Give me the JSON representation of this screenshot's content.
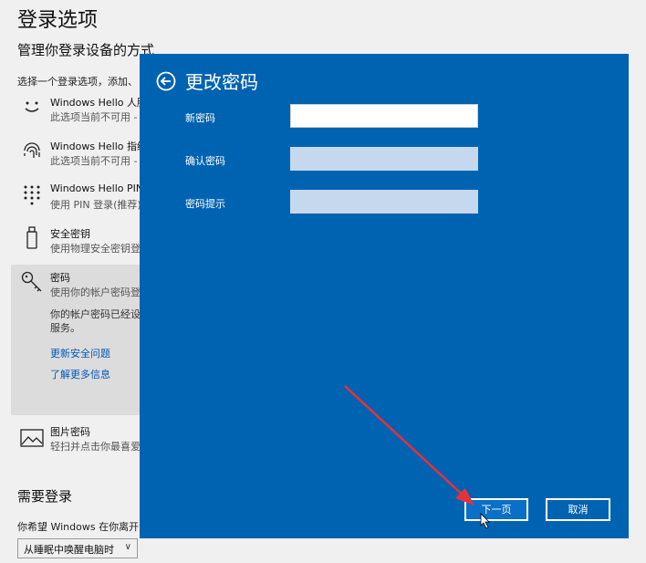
{
  "settings": {
    "title": "登录选项",
    "subtitle": "管理你登录设备的方式",
    "description": "选择一个登录选项，添加、",
    "options": [
      {
        "title": "Windows Hello 人脸",
        "subtitle": "此选项当前不可用 -",
        "icon": "face-icon"
      },
      {
        "title": "Windows Hello 指纹",
        "subtitle": "此选项当前不可用 -",
        "icon": "fingerprint-icon"
      },
      {
        "title": "Windows Hello PIN",
        "subtitle": "使用 PIN 登录(推荐)",
        "icon": "pin-keypad-icon"
      },
      {
        "title": "安全密钥",
        "subtitle": "使用物理安全密钥登",
        "icon": "usb-key-icon"
      },
      {
        "title": "密码",
        "subtitle": "使用你的帐户密码登",
        "icon": "key-icon"
      },
      {
        "title": "图片密码",
        "subtitle": "轻扫并点击你最喜爱",
        "icon": "picture-icon"
      }
    ],
    "password_note_line1": "你的帐户密码已经设",
    "password_note_line2": "服务。",
    "link_update": "更新安全问题",
    "link_learn": "了解更多信息",
    "need_login_title": "需要登录",
    "need_login_desc": "你希望 Windows 在你离开中",
    "dropdown_value": "从睡眠中唤醒电脑时"
  },
  "dialog": {
    "title": "更改密码",
    "fields": [
      {
        "label": "新密码",
        "value": ""
      },
      {
        "label": "确认密码",
        "value": ""
      },
      {
        "label": "密码提示",
        "value": ""
      }
    ],
    "next_button": "下一页",
    "cancel_button": "取消"
  },
  "colors": {
    "dialog_bg": "#0063b1",
    "annotation_arrow": "#e8303a"
  }
}
